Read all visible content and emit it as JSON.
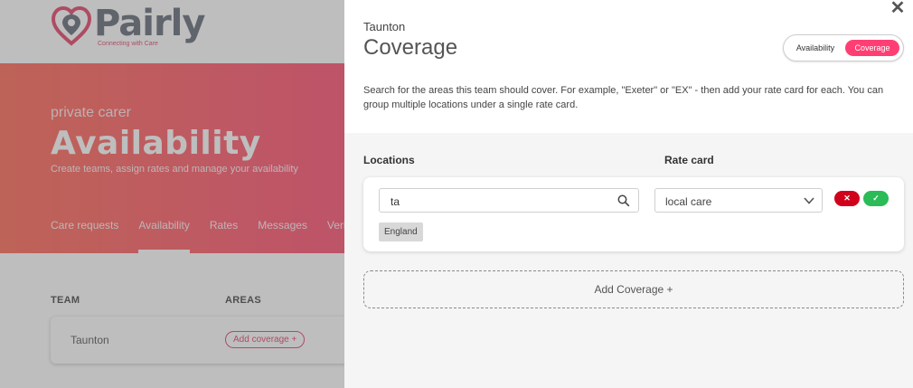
{
  "background": {
    "logo": {
      "word": "Pairly",
      "tagline": "Connecting with Care"
    },
    "hero": {
      "subtitle": "private carer",
      "title": "Availability",
      "description": "Create teams, assign rates and manage your availability"
    },
    "tabs": [
      {
        "label": "Care requests"
      },
      {
        "label": "Availability",
        "active": true
      },
      {
        "label": "Rates"
      },
      {
        "label": "Messages"
      },
      {
        "label": "Veri"
      }
    ],
    "table": {
      "headers": [
        "TEAM",
        "AREAS"
      ],
      "rows": [
        {
          "team": "Taunton",
          "action": "Add coverage +"
        }
      ]
    }
  },
  "panel": {
    "close_glyph": "✕",
    "subtitle": "Taunton",
    "title": "Coverage",
    "toggle": {
      "options": [
        "Availability",
        "Coverage"
      ],
      "selected": "Coverage"
    },
    "description": "Search for the areas this team should cover. For example, \"Exeter\" or \"EX\" - then add your rate card for each. You can group multiple locations under a single rate card.",
    "locations_label": "Locations",
    "rate_card_label": "Rate card",
    "coverage_row": {
      "search_value": "ta",
      "rate_card_selected": "local care",
      "tags": [
        "England"
      ],
      "cancel_glyph": "✕",
      "confirm_glyph": "✓"
    },
    "add_coverage_label": "Add Coverage +"
  },
  "colors": {
    "brand_pink": "#ff3f74",
    "hero_gradient_start": "#ff5a45",
    "hero_gradient_end": "#ff2f6e",
    "cancel_red": "#d0021b",
    "confirm_green": "#2bbb57"
  },
  "icons": [
    "pairly-logo-icon",
    "close-icon",
    "search-icon",
    "chevron-down-icon",
    "cancel-icon",
    "confirm-icon"
  ]
}
